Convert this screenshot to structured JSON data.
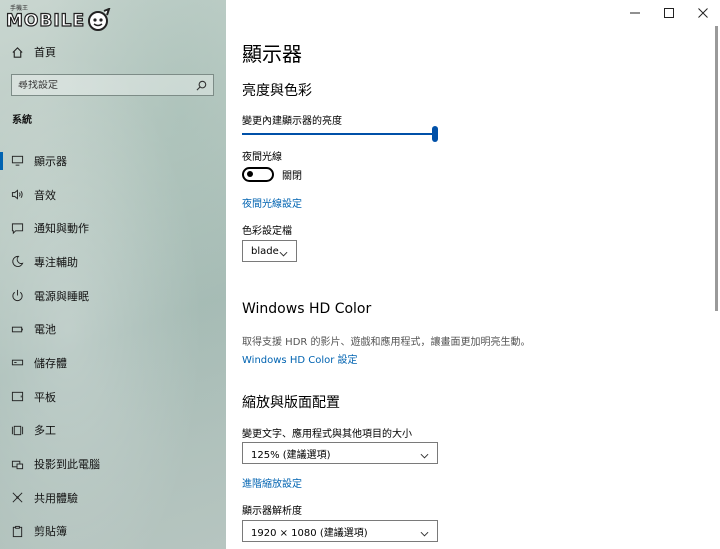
{
  "window": {
    "controls": {
      "minimize_icon": "minimize-icon",
      "maximize_icon": "maximize-icon",
      "close_icon": "close-icon"
    }
  },
  "watermark": {
    "small_text": "手機王",
    "brand_text": "MOBILE"
  },
  "sidebar": {
    "home_label": "首頁",
    "search_placeholder": "尋找設定",
    "section_title": "系統",
    "items": [
      {
        "label": "顯示器",
        "icon": "monitor-icon",
        "active": true
      },
      {
        "label": "音效",
        "icon": "speaker-icon"
      },
      {
        "label": "通知與動作",
        "icon": "notification-icon"
      },
      {
        "label": "專注輔助",
        "icon": "moon-icon"
      },
      {
        "label": "電源與睡眠",
        "icon": "power-icon"
      },
      {
        "label": "電池",
        "icon": "battery-icon"
      },
      {
        "label": "儲存體",
        "icon": "storage-icon"
      },
      {
        "label": "平板",
        "icon": "tablet-icon"
      },
      {
        "label": "多工",
        "icon": "multitask-icon"
      },
      {
        "label": "投影到此電腦",
        "icon": "project-icon"
      },
      {
        "label": "共用體驗",
        "icon": "shared-icon"
      },
      {
        "label": "剪貼簿",
        "icon": "clipboard-icon"
      }
    ]
  },
  "main": {
    "title": "顯示器",
    "brightness": {
      "heading": "亮度與色彩",
      "slider_label": "變更內建顯示器的亮度",
      "slider_value": 1.0
    },
    "night_light": {
      "label": "夜間光線",
      "toggle_state": "關閉",
      "settings_link": "夜間光線設定"
    },
    "color_profile": {
      "label": "色彩設定檔",
      "value": "blade"
    },
    "hdr": {
      "heading": "Windows HD Color",
      "description": "取得支援 HDR 的影片、遊戲和應用程式，讓畫面更加明亮生動。",
      "link": "Windows HD Color 設定"
    },
    "scale_layout": {
      "heading": "縮放與版面配置",
      "scale_label": "變更文字、應用程式與其他項目的大小",
      "scale_value": "125% (建議選項)",
      "advanced_link": "進階縮放設定",
      "resolution_label": "顯示器解析度",
      "resolution_value": "1920 × 1080 (建議選項)"
    }
  }
}
